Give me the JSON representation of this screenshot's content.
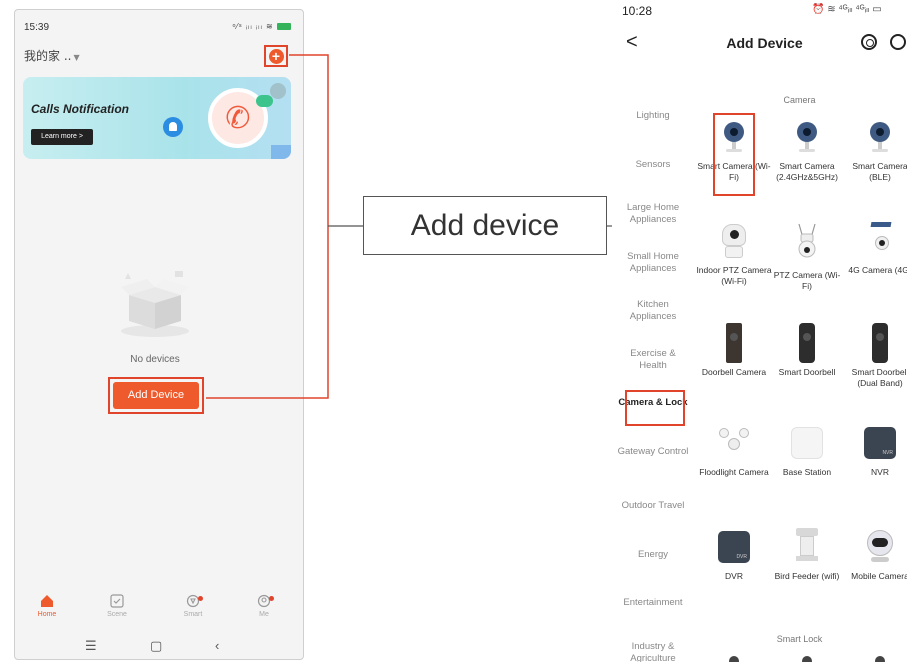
{
  "left_phone": {
    "status": {
      "time": "15:39",
      "icons": "ᵒ⁄ˢ ᵢₗₗ ᵢₗₗ ≋"
    },
    "home_title": "我的家 ..",
    "banner": {
      "title": "Calls Notification",
      "button": "Learn more >"
    },
    "empty_text": "No devices",
    "add_button": "Add Device",
    "tabs": [
      {
        "label": "Home"
      },
      {
        "label": "Scene"
      },
      {
        "label": "Smart"
      },
      {
        "label": "Me"
      }
    ],
    "accent_color": "#ee5a2b"
  },
  "callout": {
    "text": "Add device",
    "highlight_color": "#e0452c"
  },
  "right_phone": {
    "status": {
      "time": "10:28",
      "icons": "⏰ ≋ ⁴ᴳᵢₗₗ ⁴ᴳᵢₗₗ ▭"
    },
    "title": "Add Device",
    "back": "<",
    "categories": [
      {
        "label": "Lighting"
      },
      {
        "label": "Sensors"
      },
      {
        "label": "Large Home Appliances"
      },
      {
        "label": "Small Home Appliances"
      },
      {
        "label": "Kitchen Appliances"
      },
      {
        "label": "Exercise & Health"
      },
      {
        "label": "Camera & Lock"
      },
      {
        "label": "Gateway Control"
      },
      {
        "label": "Outdoor Travel"
      },
      {
        "label": "Energy"
      },
      {
        "label": "Entertainment"
      },
      {
        "label": "Industry & Agriculture"
      }
    ],
    "active_category": "Camera & Lock",
    "sections": {
      "camera": "Camera",
      "smart_lock": "Smart Lock"
    },
    "devices": [
      {
        "name": "Smart Camera (Wi-Fi)",
        "icon": "bullet-camera-icon"
      },
      {
        "name": "Smart Camera (2.4GHz&5GHz)",
        "icon": "bullet-camera-icon"
      },
      {
        "name": "Smart Camera (BLE)",
        "icon": "bullet-camera-icon"
      },
      {
        "name": "Indoor PTZ Camera (Wi-Fi)",
        "icon": "ptz-camera-icon"
      },
      {
        "name": "PTZ Camera (Wi-Fi)",
        "icon": "outdoor-ptz-camera-icon"
      },
      {
        "name": "4G Camera (4G)",
        "icon": "solar-camera-icon"
      },
      {
        "name": "Doorbell Camera",
        "icon": "doorbell-icon"
      },
      {
        "name": "Smart Doorbell",
        "icon": "doorbell-icon"
      },
      {
        "name": "Smart Doorbell (Dual Band)",
        "icon": "doorbell-icon"
      },
      {
        "name": "Floodlight Camera",
        "icon": "floodlight-icon"
      },
      {
        "name": "Base Station",
        "icon": "base-station-icon"
      },
      {
        "name": "NVR",
        "icon": "nvr-icon",
        "tag": "NVR"
      },
      {
        "name": "DVR",
        "icon": "dvr-icon",
        "tag": "DVR"
      },
      {
        "name": "Bird Feeder (wifi)",
        "icon": "bird-feeder-icon"
      },
      {
        "name": "Mobile Camera",
        "icon": "robot-camera-icon"
      }
    ]
  }
}
